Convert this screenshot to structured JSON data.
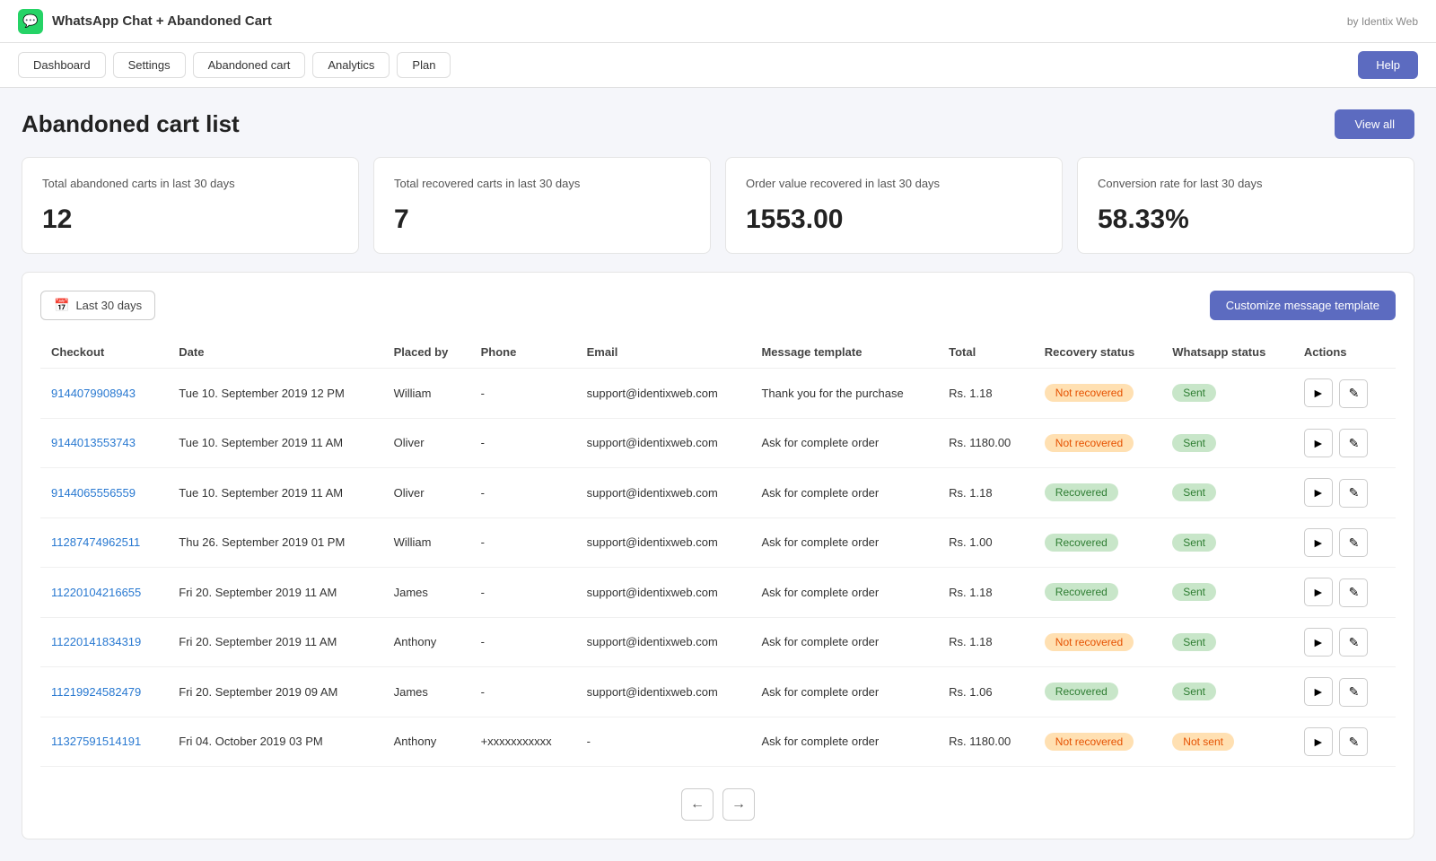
{
  "app": {
    "title": "WhatsApp Chat + Abandoned Cart",
    "by_label": "by Identix Web",
    "icon_symbol": "💬"
  },
  "nav": {
    "items": [
      {
        "label": "Dashboard",
        "id": "dashboard"
      },
      {
        "label": "Settings",
        "id": "settings"
      },
      {
        "label": "Abandoned cart",
        "id": "abandoned-cart"
      },
      {
        "label": "Analytics",
        "id": "analytics"
      },
      {
        "label": "Plan",
        "id": "plan"
      }
    ],
    "help_label": "Help"
  },
  "page": {
    "title": "Abandoned cart list",
    "view_all_label": "View all"
  },
  "stats": [
    {
      "label": "Total abandoned carts in last 30 days",
      "value": "12"
    },
    {
      "label": "Total recovered carts in last 30 days",
      "value": "7"
    },
    {
      "label": "Order value recovered in last 30 days",
      "value": "1553.00"
    },
    {
      "label": "Conversion rate for last 30 days",
      "value": "58.33%"
    }
  ],
  "table": {
    "date_filter_label": "Last 30 days",
    "customize_btn_label": "Customize message template",
    "columns": [
      "Checkout",
      "Date",
      "Placed by",
      "Phone",
      "Email",
      "Message template",
      "Total",
      "Recovery status",
      "Whatsapp status",
      "Actions"
    ],
    "rows": [
      {
        "checkout": "9144079908943",
        "date": "Tue 10. September 2019 12 PM",
        "placed_by": "William",
        "phone": "-",
        "email": "support@identixweb.com",
        "message_template": "Thank you for the purchase",
        "total": "Rs. 1.18",
        "recovery_status": "Not recovered",
        "recovery_status_type": "not-recovered",
        "whatsapp_status": "Sent",
        "whatsapp_status_type": "sent"
      },
      {
        "checkout": "9144013553743",
        "date": "Tue 10. September 2019 11 AM",
        "placed_by": "Oliver",
        "phone": "-",
        "email": "support@identixweb.com",
        "message_template": "Ask for complete order",
        "total": "Rs. 1180.00",
        "recovery_status": "Not recovered",
        "recovery_status_type": "not-recovered",
        "whatsapp_status": "Sent",
        "whatsapp_status_type": "sent"
      },
      {
        "checkout": "9144065556559",
        "date": "Tue 10. September 2019 11 AM",
        "placed_by": "Oliver",
        "phone": "-",
        "email": "support@identixweb.com",
        "message_template": "Ask for complete order",
        "total": "Rs. 1.18",
        "recovery_status": "Recovered",
        "recovery_status_type": "recovered",
        "whatsapp_status": "Sent",
        "whatsapp_status_type": "sent"
      },
      {
        "checkout": "11287474962511",
        "date": "Thu 26. September 2019 01 PM",
        "placed_by": "William",
        "phone": "-",
        "email": "support@identixweb.com",
        "message_template": "Ask for complete order",
        "total": "Rs. 1.00",
        "recovery_status": "Recovered",
        "recovery_status_type": "recovered",
        "whatsapp_status": "Sent",
        "whatsapp_status_type": "sent"
      },
      {
        "checkout": "11220104216655",
        "date": "Fri 20. September 2019 11 AM",
        "placed_by": "James",
        "phone": "-",
        "email": "support@identixweb.com",
        "message_template": "Ask for complete order",
        "total": "Rs. 1.18",
        "recovery_status": "Recovered",
        "recovery_status_type": "recovered",
        "whatsapp_status": "Sent",
        "whatsapp_status_type": "sent"
      },
      {
        "checkout": "11220141834319",
        "date": "Fri 20. September 2019 11 AM",
        "placed_by": "Anthony",
        "phone": "-",
        "email": "support@identixweb.com",
        "message_template": "Ask for complete order",
        "total": "Rs. 1.18",
        "recovery_status": "Not recovered",
        "recovery_status_type": "not-recovered",
        "whatsapp_status": "Sent",
        "whatsapp_status_type": "sent"
      },
      {
        "checkout": "11219924582479",
        "date": "Fri 20. September 2019 09 AM",
        "placed_by": "James",
        "phone": "-",
        "email": "support@identixweb.com",
        "message_template": "Ask for complete order",
        "total": "Rs. 1.06",
        "recovery_status": "Recovered",
        "recovery_status_type": "recovered",
        "whatsapp_status": "Sent",
        "whatsapp_status_type": "sent"
      },
      {
        "checkout": "11327591514191",
        "date": "Fri 04. October 2019 03 PM",
        "placed_by": "Anthony",
        "phone": "+xxxxxxxxxxx",
        "email": "-",
        "message_template": "Ask for complete order",
        "total": "Rs. 1180.00",
        "recovery_status": "Not recovered",
        "recovery_status_type": "not-recovered",
        "whatsapp_status": "Not sent",
        "whatsapp_status_type": "not-sent"
      }
    ]
  },
  "pagination": {
    "prev_label": "←",
    "next_label": "→"
  }
}
